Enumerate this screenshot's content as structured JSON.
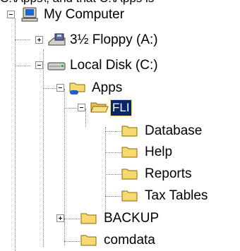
{
  "top_clip_text": "C:\\Apps\\, and that C:\\Apps is",
  "tree": [
    {
      "label": "My Computer",
      "icon": "computer-icon",
      "expander": "minus",
      "selected": false
    },
    {
      "label": "3½ Floppy (A:)",
      "icon": "floppy-drive-icon",
      "expander": "plus",
      "selected": false
    },
    {
      "label": "Local Disk (C:)",
      "icon": "hard-drive-icon",
      "expander": "minus",
      "selected": false
    },
    {
      "label": "Apps",
      "icon": "folder-shared-icon",
      "expander": "minus",
      "selected": false
    },
    {
      "label": "FLI",
      "icon": "folder-open-icon",
      "expander": "minus",
      "selected": true
    },
    {
      "label": "Database",
      "icon": "folder-icon",
      "expander": "none",
      "selected": false
    },
    {
      "label": "Help",
      "icon": "folder-icon",
      "expander": "none",
      "selected": false
    },
    {
      "label": "Reports",
      "icon": "folder-icon",
      "expander": "none",
      "selected": false
    },
    {
      "label": "Tax Tables",
      "icon": "folder-icon",
      "expander": "none",
      "selected": false
    },
    {
      "label": "BACKUP",
      "icon": "folder-icon",
      "expander": "plus",
      "selected": false
    },
    {
      "label": "comdata",
      "icon": "folder-icon",
      "expander": "none",
      "selected": false
    }
  ],
  "colors": {
    "selection_bg": "#0a246a",
    "folder_yellow": "#f8d870",
    "tree_line": "#808080"
  }
}
